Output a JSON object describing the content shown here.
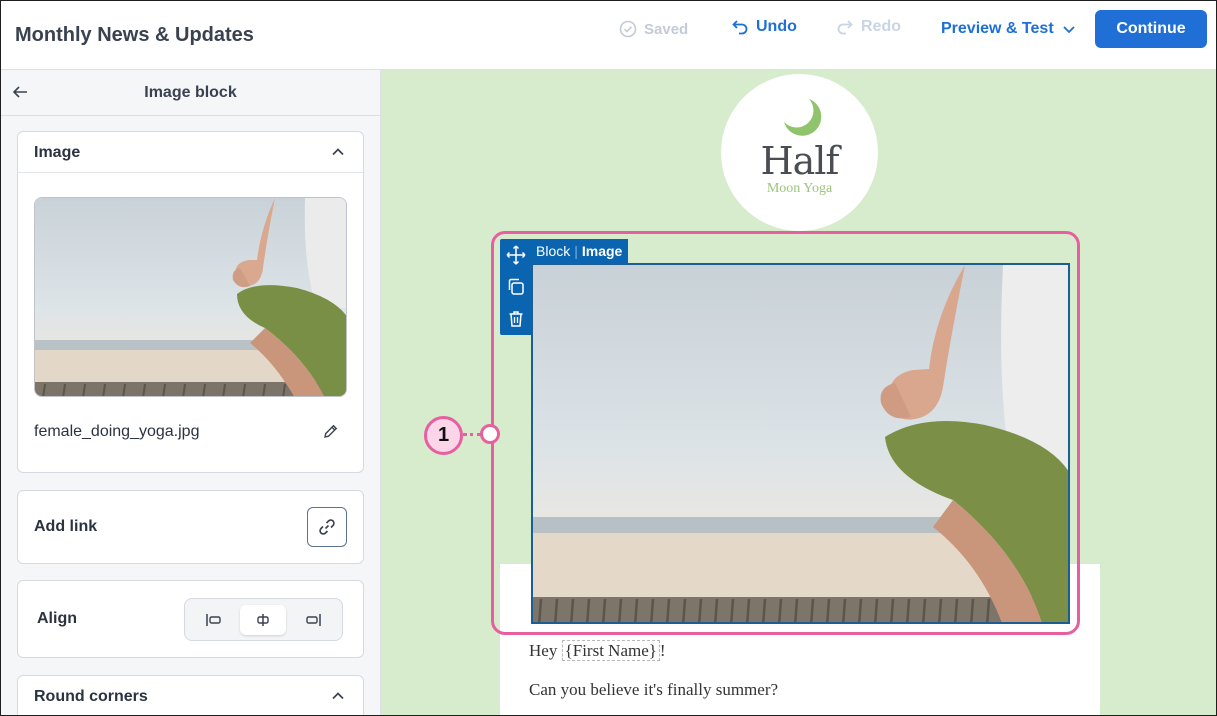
{
  "header": {
    "title": "Monthly News & Updates",
    "saved_label": "Saved",
    "undo_label": "Undo",
    "redo_label": "Redo",
    "preview_label": "Preview & Test",
    "continue_label": "Continue"
  },
  "panel": {
    "title": "Image block",
    "image_section": {
      "label": "Image",
      "filename": "female_doing_yoga.jpg"
    },
    "link_section": {
      "label": "Add link"
    },
    "align_section": {
      "label": "Align",
      "options": [
        "left",
        "center",
        "right"
      ],
      "selected": "center"
    },
    "round_section": {
      "label": "Round corners"
    }
  },
  "canvas": {
    "logo": {
      "line1": "Half",
      "line2": "Moon Yoga"
    },
    "block_tag": {
      "type": "Block",
      "name": "Image"
    },
    "greeting_prefix": "Hey ",
    "first_name_token": "{First Name}",
    "greeting_suffix": "!",
    "body_line": "Can you believe it's finally summer?"
  },
  "callout": {
    "number": "1"
  },
  "colors": {
    "accent": "#1f6fd6",
    "canvas_bg": "#d7ebcd",
    "callout": "#e85fa0",
    "block_toolbar": "#0b64b0"
  }
}
